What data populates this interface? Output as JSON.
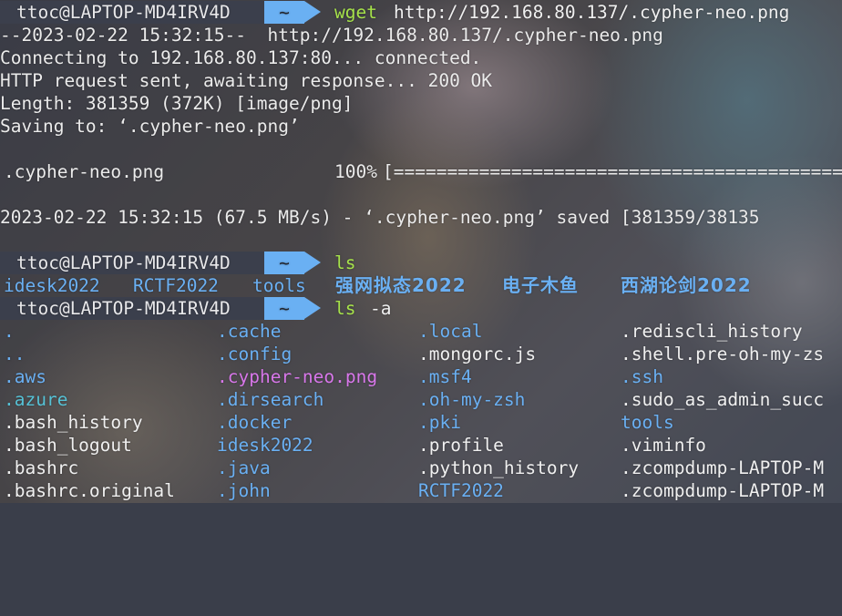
{
  "prompt": {
    "user_host": "ttoc@LAPTOP-MD4IRV4D",
    "dir": "~"
  },
  "command1": {
    "cmd": "wget",
    "arg": "http://192.168.80.137/.cypher-neo.png"
  },
  "wget_output": [
    "--2023-02-22 15:32:15--  http://192.168.80.137/.cypher-neo.png",
    "Connecting to 192.168.80.137:80... connected.",
    "HTTP request sent, awaiting response... 200 OK",
    "Length: 381359 (372K) [image/png]",
    "Saving to: ‘.cypher-neo.png’"
  ],
  "progress": {
    "filename": ".cypher-neo.png",
    "percent_label": "100%",
    "bar": "[=========================================="
  },
  "saved_line": "2023-02-22 15:32:15 (67.5 MB/s) - ‘.cypher-neo.png’ saved [381359/38135",
  "command2": {
    "cmd": "ls"
  },
  "ls_output": [
    "idesk2022",
    "RCTF2022",
    "tools",
    "强网拟态2022",
    "电子木鱼",
    "西湖论剑2022"
  ],
  "command3": {
    "cmd": "ls",
    "arg": "-a"
  },
  "ls_a_rows": [
    [
      ".",
      ".cache",
      ".local",
      ".rediscli_history"
    ],
    [
      "..",
      ".config",
      ".mongorc.js",
      ".shell.pre-oh-my-zs"
    ],
    [
      ".aws",
      ".cypher-neo.png",
      ".msf4",
      ".ssh"
    ],
    [
      ".azure",
      ".dirsearch",
      ".oh-my-zsh",
      ".sudo_as_admin_succ"
    ],
    [
      ".bash_history",
      ".docker",
      ".pki",
      "tools"
    ],
    [
      ".bash_logout",
      "idesk2022",
      ".profile",
      ".viminfo"
    ],
    [
      ".bashrc",
      ".java",
      ".python_history",
      ".zcompdump-LAPTOP-M"
    ],
    [
      ".bashrc.original",
      ".john",
      "RCTF2022",
      ".zcompdump-LAPTOP-M"
    ]
  ],
  "colors": {
    "prompt_user_bg": "#3b3f4c",
    "prompt_dir_bg": "#6ab0f3",
    "command": "#a6e24a",
    "directory": "#6ab0f3",
    "image_file": "#d877ea",
    "plain_file": "#f0f0f0"
  }
}
